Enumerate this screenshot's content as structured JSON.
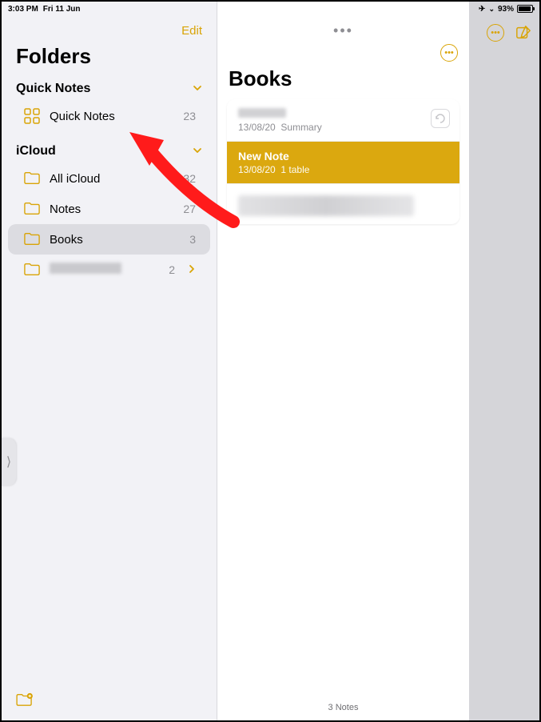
{
  "status": {
    "time": "3:03 PM",
    "date": "Fri 11 Jun",
    "battery_pct": "93%"
  },
  "sidebar": {
    "edit_label": "Edit",
    "title": "Folders",
    "sections": [
      {
        "name": "Quick Notes",
        "items": [
          {
            "label": "Quick Notes",
            "count": "23",
            "icon": "grid"
          }
        ]
      },
      {
        "name": "iCloud",
        "items": [
          {
            "label": "All iCloud",
            "count": "32",
            "icon": "folder"
          },
          {
            "label": "Notes",
            "count": "27",
            "icon": "folder"
          },
          {
            "label": "Books",
            "count": "3",
            "icon": "folder",
            "selected": true
          },
          {
            "label": "",
            "count": "2",
            "icon": "folder",
            "chevron": true,
            "redacted": true
          }
        ]
      }
    ]
  },
  "main": {
    "title": "Books",
    "notes": [
      {
        "title_redacted": true,
        "meta_date": "13/08/20",
        "meta_text": "Summary",
        "sync_badge": true
      },
      {
        "title": "New Note",
        "meta_date": "13/08/20",
        "meta_text": "1 table",
        "selected": true
      },
      {
        "body_redacted": true
      }
    ],
    "footer": "3 Notes"
  },
  "accent": "#d9a406"
}
